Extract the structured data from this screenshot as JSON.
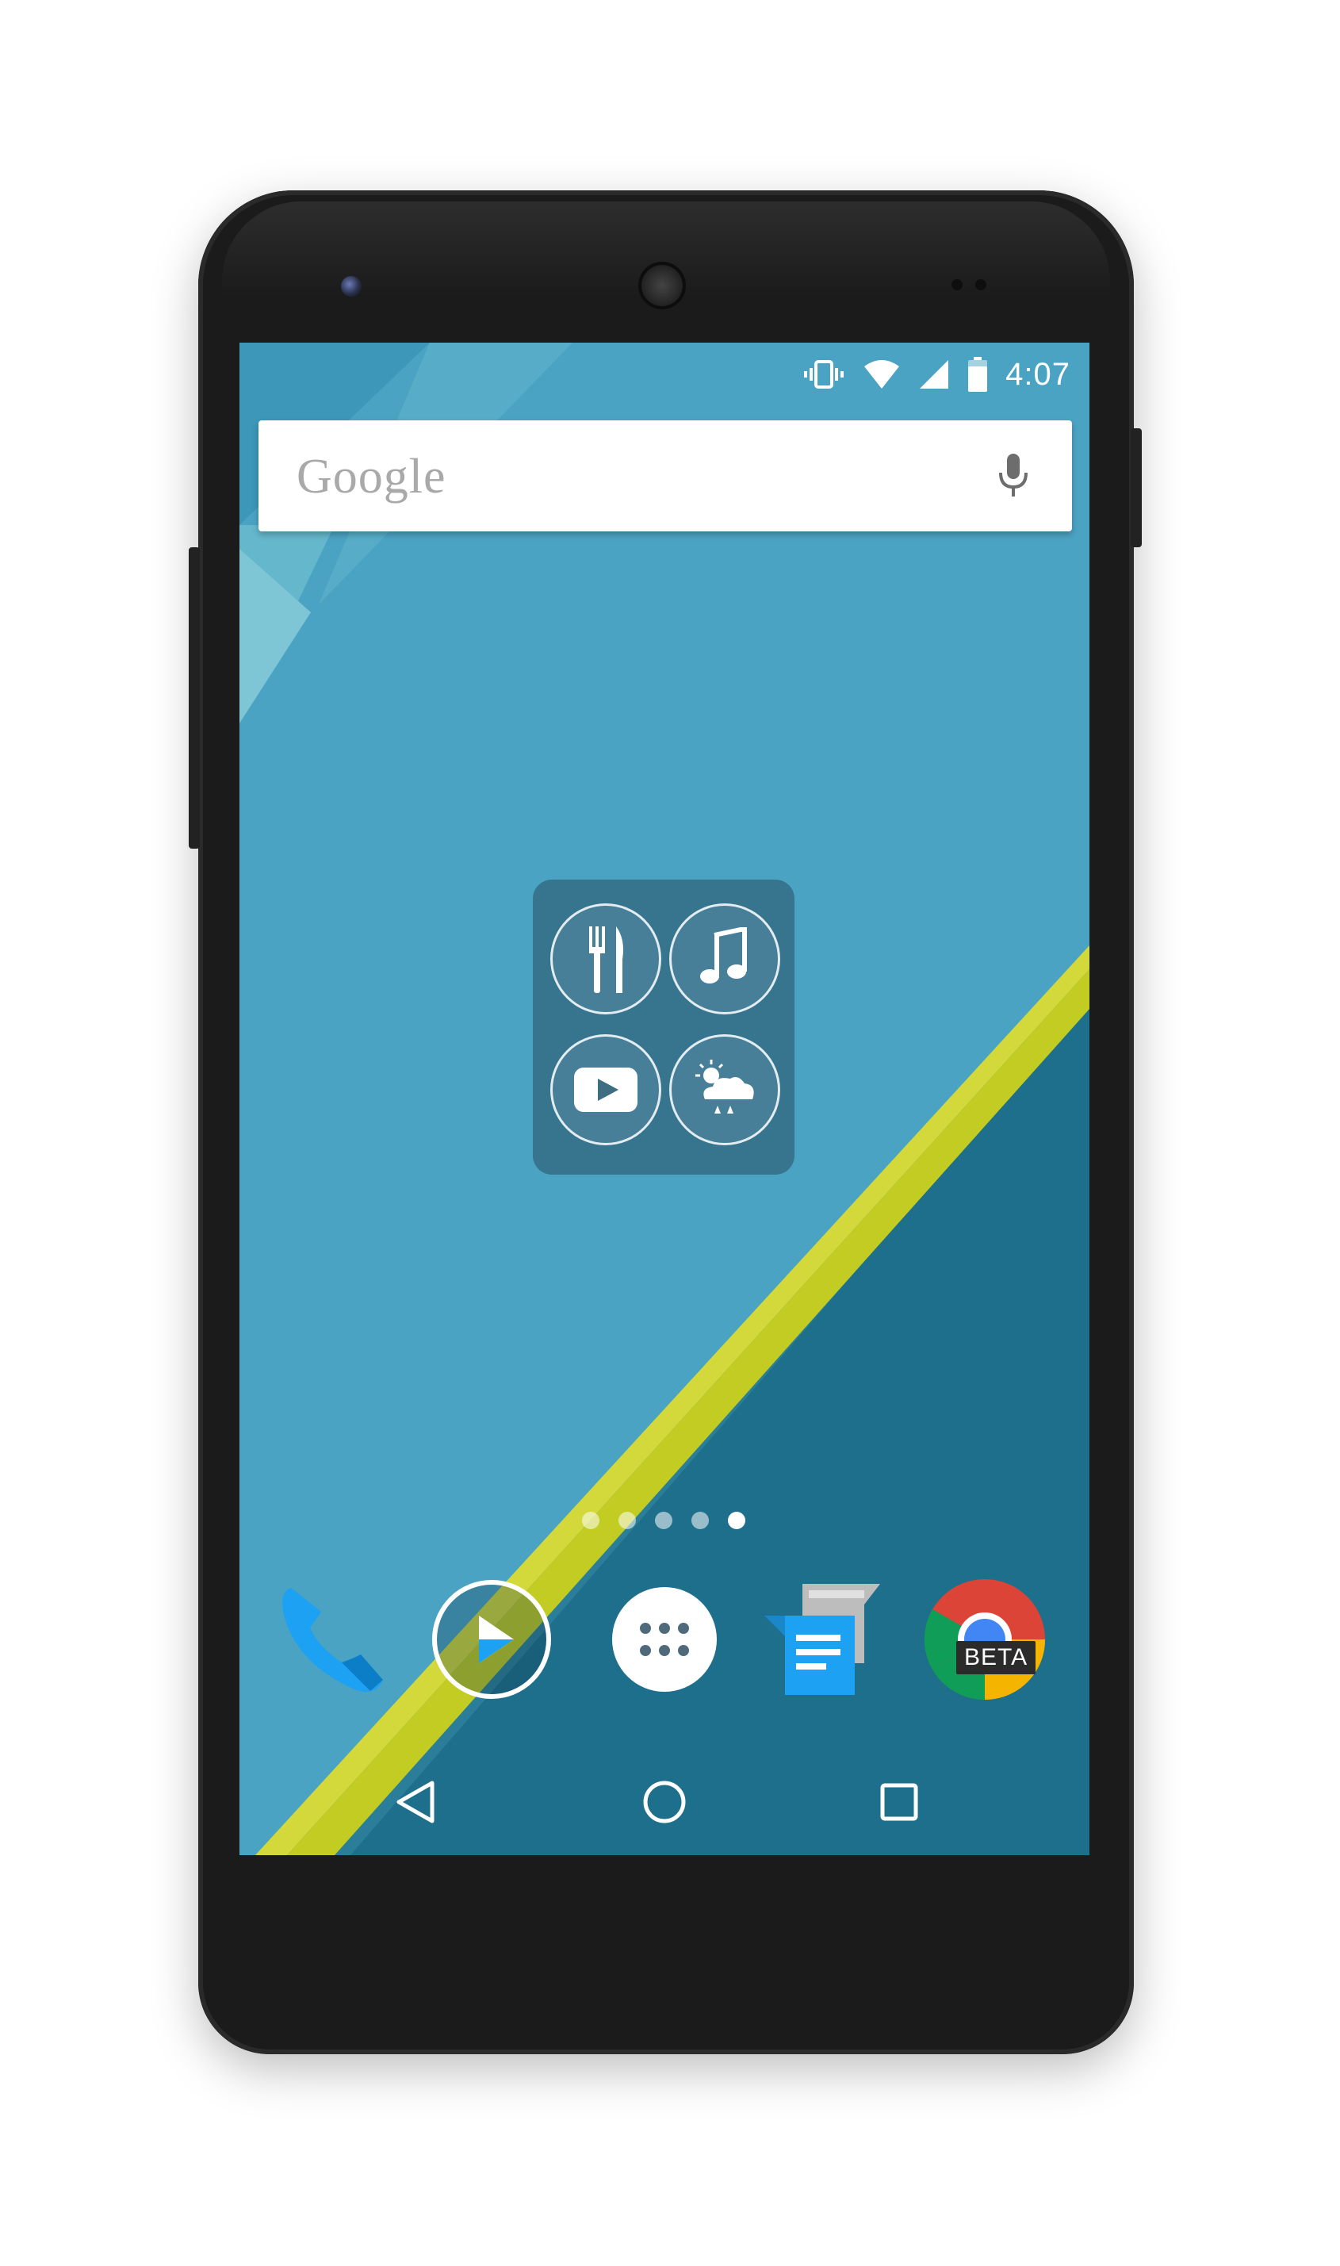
{
  "device": {
    "model_hint": "android-phone"
  },
  "status_bar": {
    "time": "4:07",
    "icons": [
      "vibrate-icon",
      "wifi-icon",
      "cell-signal-icon",
      "battery-icon"
    ]
  },
  "search_widget": {
    "logo_text": "Google",
    "mic_icon": "mic-icon"
  },
  "folder": {
    "apps": [
      {
        "icon": "fork-knife-icon"
      },
      {
        "icon": "music-note-icon"
      },
      {
        "icon": "youtube-icon"
      },
      {
        "icon": "weather-icon"
      }
    ]
  },
  "page_indicator": {
    "count": 5,
    "active_index": 4
  },
  "dock": {
    "apps": [
      {
        "icon": "phone-icon"
      },
      {
        "icon": "play-icon"
      },
      {
        "icon": "app-drawer-icon"
      },
      {
        "icon": "messaging-icon"
      },
      {
        "icon": "chrome-beta-icon",
        "badge": "BETA"
      }
    ]
  },
  "nav_bar": {
    "buttons": [
      "back-icon",
      "home-icon",
      "recents-icon"
    ]
  },
  "colors": {
    "wallpaper_light": "#4aa2c2",
    "wallpaper_dark": "#1f6f8c",
    "accent_stripe": "#c9d22a",
    "phone_body": "#1b1b1b",
    "dock_phone_blue": "#1da1f2"
  }
}
